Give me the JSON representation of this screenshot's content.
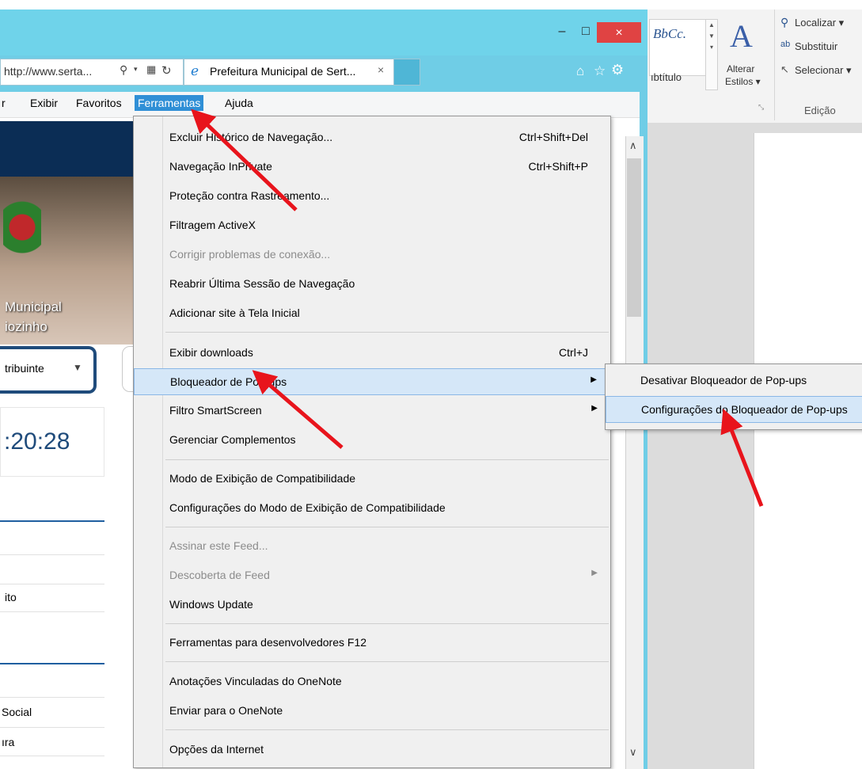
{
  "browser": {
    "address_url": "http://www.serta...",
    "tab_title": "Prefeitura Municipal de Sert...",
    "menubar": [
      "r",
      "Exibir",
      "Favoritos",
      "Ferramentas",
      "Ajuda"
    ],
    "window_controls": {
      "minimize": "–",
      "maximize": "□",
      "close": "×"
    }
  },
  "page": {
    "site_title_line1": "Municipal",
    "site_title_line2": "iozinho",
    "select_value": "tribuinte",
    "clock": ":20:28",
    "links": [
      "ito",
      "Social",
      "ıra"
    ]
  },
  "tools_menu": {
    "items": [
      {
        "label": "Excluir Histórico de Navegação...",
        "shortcut": "Ctrl+Shift+Del"
      },
      {
        "label": "Navegação InPrivate",
        "shortcut": "Ctrl+Shift+P"
      },
      {
        "label": "Proteção contra Rastreamento..."
      },
      {
        "label": "Filtragem ActiveX"
      },
      {
        "label": "Corrigir problemas de conexão..."
      },
      {
        "label": "Reabrir Última Sessão de Navegação"
      },
      {
        "label": "Adicionar site à Tela Inicial"
      },
      {
        "label": "Exibir downloads",
        "shortcut": "Ctrl+J"
      },
      {
        "label": "Bloqueador de Pop-ups"
      },
      {
        "label": "Filtro SmartScreen"
      },
      {
        "label": "Gerenciar Complementos"
      },
      {
        "label": "Modo de Exibição de Compatibilidade"
      },
      {
        "label": "Configurações do Modo de Exibição de Compatibilidade"
      },
      {
        "label": "Assinar este Feed..."
      },
      {
        "label": "Descoberta de Feed"
      },
      {
        "label": "Windows Update"
      },
      {
        "label": "Ferramentas para desenvolvedores F12"
      },
      {
        "label": "Anotações Vinculadas do OneNote"
      },
      {
        "label": "Enviar para o OneNote"
      },
      {
        "label": "Opções da Internet"
      }
    ]
  },
  "popup_submenu": {
    "items": [
      {
        "label": "Desativar Bloqueador de Pop-ups"
      },
      {
        "label": "Configurações do Bloqueador de Pop-ups"
      }
    ]
  },
  "word_ribbon": {
    "style_preview": "BbCc.",
    "style_name": "ıbtítulo",
    "change_styles": [
      "Alterar",
      "Estilos ▾"
    ],
    "find": "Localizar ▾",
    "replace": "Substituir",
    "select": "Selecionar ▾",
    "group_label": "Edição"
  },
  "colors": {
    "annotation_arrow": "#e8141c",
    "menu_highlight": "#d5e7f8",
    "ie_frame": "#6fd3ea",
    "close_button": "#e04343"
  }
}
